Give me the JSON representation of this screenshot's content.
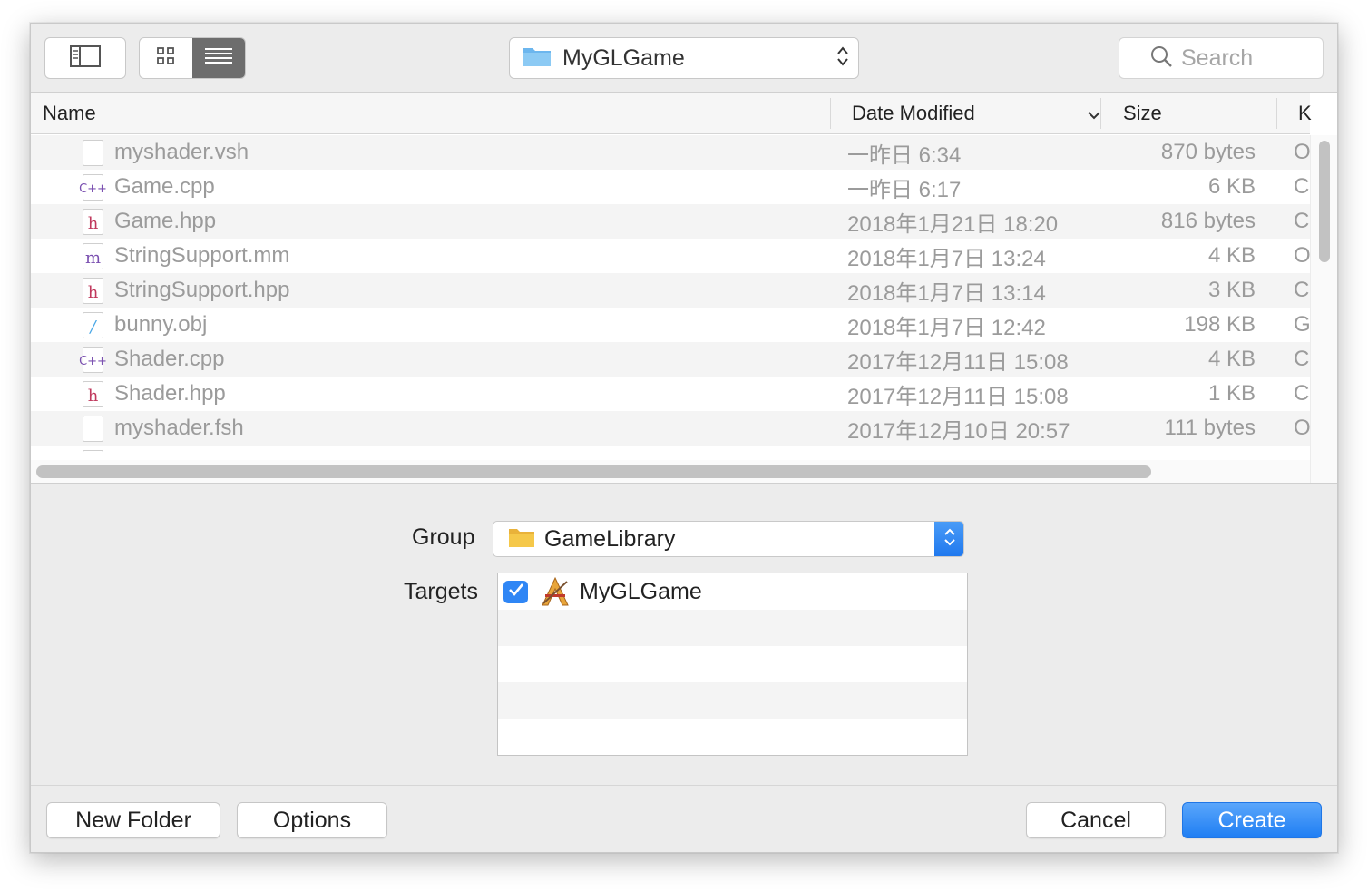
{
  "toolbar": {
    "location": "MyGLGame",
    "search_placeholder": "Search"
  },
  "columns": {
    "name": "Name",
    "date": "Date Modified",
    "size": "Size",
    "kind": "K"
  },
  "files": [
    {
      "name": "myshader.vsh",
      "icon": "blank",
      "date": "一昨日 6:34",
      "size": "870 bytes",
      "kind": "O"
    },
    {
      "name": "Game.cpp",
      "icon": "cpp",
      "date": "一昨日 6:17",
      "size": "6 KB",
      "kind": "C"
    },
    {
      "name": "Game.hpp",
      "icon": "h",
      "date": "2018年1月21日 18:20",
      "size": "816 bytes",
      "kind": "C"
    },
    {
      "name": "StringSupport.mm",
      "icon": "m",
      "date": "2018年1月7日 13:24",
      "size": "4 KB",
      "kind": "O"
    },
    {
      "name": "StringSupport.hpp",
      "icon": "h",
      "date": "2018年1月7日 13:14",
      "size": "3 KB",
      "kind": "C"
    },
    {
      "name": "bunny.obj",
      "icon": "obj",
      "date": "2018年1月7日 12:42",
      "size": "198 KB",
      "kind": "G"
    },
    {
      "name": "Shader.cpp",
      "icon": "cpp",
      "date": "2017年12月11日 15:08",
      "size": "4 KB",
      "kind": "C"
    },
    {
      "name": "Shader.hpp",
      "icon": "h",
      "date": "2017年12月11日 15:08",
      "size": "1 KB",
      "kind": "C"
    },
    {
      "name": "myshader.fsh",
      "icon": "blank",
      "date": "2017年12月10日 20:57",
      "size": "111 bytes",
      "kind": "O"
    }
  ],
  "options": {
    "group_label": "Group",
    "group_value": "GameLibrary",
    "targets_label": "Targets",
    "targets": [
      {
        "name": "MyGLGame",
        "checked": true
      }
    ]
  },
  "footer": {
    "new_folder": "New Folder",
    "options": "Options",
    "cancel": "Cancel",
    "create": "Create"
  },
  "colors": {
    "accent": "#2f86f5",
    "folder_blue": "#6cb6ee",
    "folder_yellow": "#f5c84a",
    "h_icon": "#c0395d",
    "cpp_icon": "#7a4fb0",
    "m_icon": "#7a4fb0",
    "obj_icon": "#4aa7e6"
  }
}
